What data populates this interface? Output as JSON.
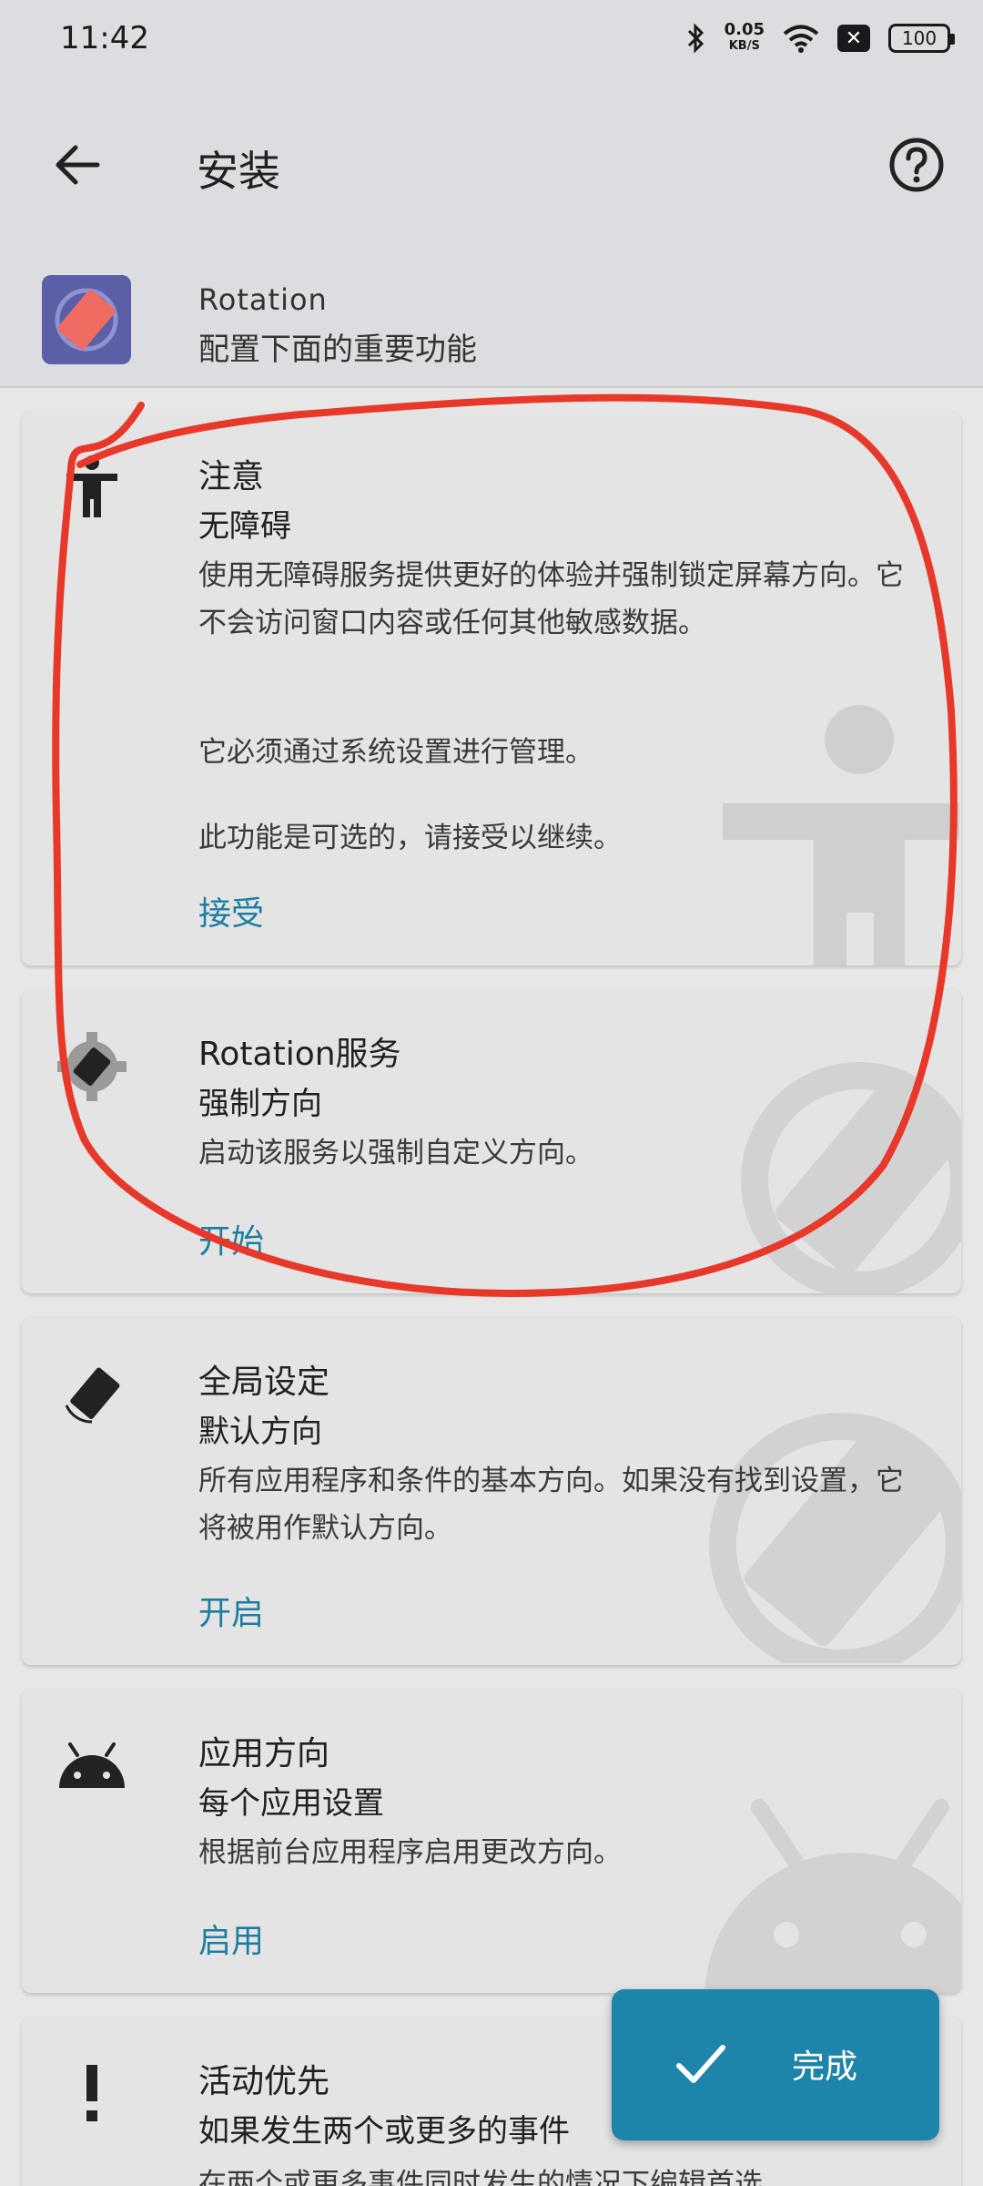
{
  "status_bar": {
    "time": "11:42",
    "net_speed_value": "0.05",
    "net_speed_unit": "KB/S",
    "x_badge": "✕",
    "battery": "100",
    "icons": [
      "bluetooth-icon",
      "wifi-icon"
    ]
  },
  "toolbar": {
    "title": "安装",
    "back_icon": "arrow-back-icon",
    "help_icon": "help-circle-icon"
  },
  "app_header": {
    "name": "Rotation",
    "subtitle": "配置下面的重要功能"
  },
  "cards": [
    {
      "title": "注意",
      "subtitle": "无障碍",
      "desc_1": "使用无障碍服务提供更好的体验并强制锁定屏幕方向。它不会访问窗口内容或任何其他敏感数据。",
      "desc_2": "它必须通过系统设置进行管理。",
      "desc_3": "此功能是可选的，请接受以继续。",
      "action": "接受",
      "icon": "accessibility-icon"
    },
    {
      "title": "Rotation服务",
      "subtitle": "强制方向",
      "desc_1": "启动该服务以强制自定义方向。",
      "action": "开始",
      "icon": "gear-rotation-icon"
    },
    {
      "title": "全局设定",
      "subtitle": "默认方向",
      "desc_1": "所有应用程序和条件的基本方向。如果没有找到设置，它将被用作默认方向。",
      "action": "开启",
      "icon": "screen-rotation-icon"
    },
    {
      "title": "应用方向",
      "subtitle": "每个应用设置",
      "desc_1": "根据前台应用程序启用更改方向。",
      "action": "启用",
      "icon": "android-icon"
    },
    {
      "title": "活动优先",
      "subtitle": "如果发生两个或更多的事件",
      "desc_1": "在两个或更多事件同时发生的情况下编辑首选",
      "icon": "priority-icon"
    }
  ],
  "fab": {
    "label": "完成",
    "icon": "check-icon"
  },
  "colors": {
    "accent": "#1b7ea1",
    "fab": "#1d84aa",
    "annotation": "#e8382a"
  }
}
